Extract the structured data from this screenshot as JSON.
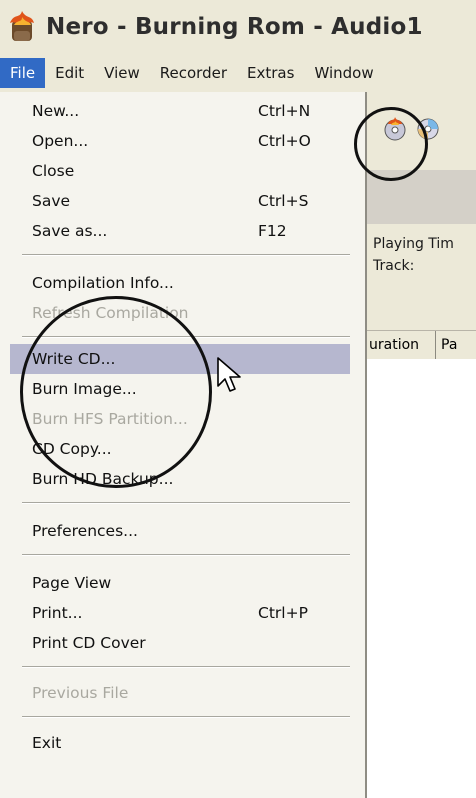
{
  "titlebar": {
    "title": "Nero - Burning Rom - Audio1",
    "icon": "nero-flame-icon"
  },
  "menubar": {
    "items": [
      {
        "label": "File",
        "active": true
      },
      {
        "label": "Edit"
      },
      {
        "label": "View"
      },
      {
        "label": "Recorder"
      },
      {
        "label": "Extras"
      },
      {
        "label": "Window"
      }
    ]
  },
  "file_menu": {
    "new": {
      "label": "New...",
      "shortcut": "Ctrl+N"
    },
    "open": {
      "label": "Open...",
      "shortcut": "Ctrl+O"
    },
    "close": {
      "label": "Close"
    },
    "save": {
      "label": "Save",
      "shortcut": "Ctrl+S"
    },
    "save_as": {
      "label": "Save as...",
      "shortcut": "F12"
    },
    "compilation_info": {
      "label": "Compilation Info..."
    },
    "refresh_compilation": {
      "label": "Refresh Compilation",
      "disabled": true
    },
    "write_cd": {
      "label": "Write CD...",
      "highlighted": true
    },
    "burn_image": {
      "label": "Burn Image..."
    },
    "burn_hfs": {
      "label": "Burn HFS Partition...",
      "disabled": true
    },
    "cd_copy": {
      "label": "CD Copy..."
    },
    "burn_hd_backup": {
      "label": "Burn HD Backup..."
    },
    "preferences": {
      "label": "Preferences..."
    },
    "page_view": {
      "label": "Page View"
    },
    "print": {
      "label": "Print...",
      "shortcut": "Ctrl+P"
    },
    "print_cd_cover": {
      "label": "Print CD Cover"
    },
    "previous_file": {
      "label": "Previous File",
      "disabled": true
    },
    "exit": {
      "label": "Exit"
    }
  },
  "info_panel": {
    "playing_time_label": "Playing Tim",
    "track_label": "Track:"
  },
  "columns": {
    "duration": "uration",
    "pause": "Pa"
  },
  "toolbar": {
    "icons": [
      "burn-icon",
      "cd-copy-icon"
    ]
  },
  "colors": {
    "highlight": "#b6b7cf",
    "menu_bg": "#f5f4ee",
    "chrome": "#ece9d8",
    "active_menu": "#316ac5"
  }
}
